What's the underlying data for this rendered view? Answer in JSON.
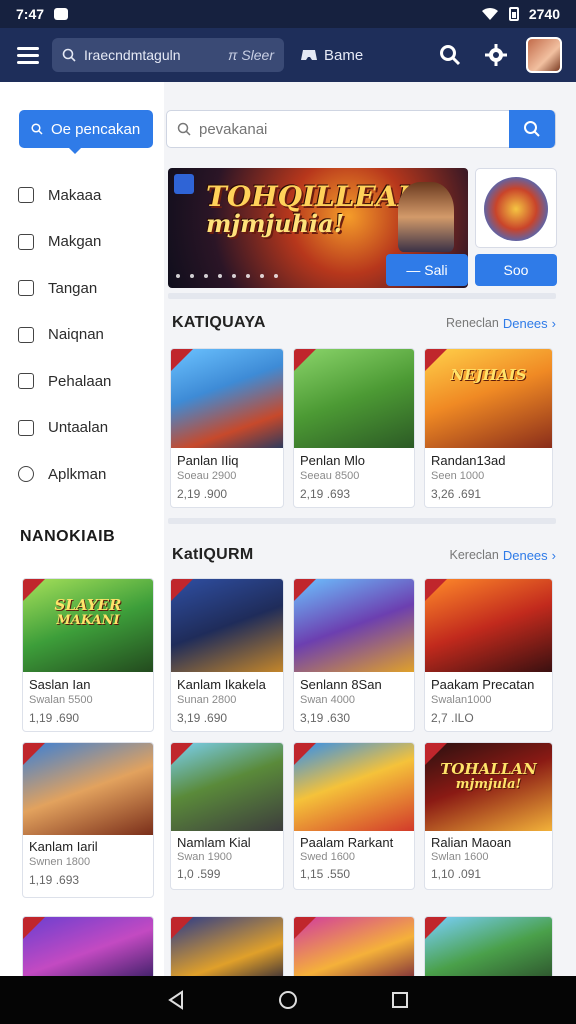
{
  "status_bar": {
    "time": "7:47",
    "battery_text": "2740"
  },
  "app_bar": {
    "search_text": "Iraecndmtaguln",
    "divider_label": "Sleer",
    "game_label": "Bame"
  },
  "sidebar": {
    "category_button": "Oe pencakan",
    "items": [
      {
        "label": "Makaaa",
        "icon": "bookmark-icon"
      },
      {
        "label": "Makgan",
        "icon": "tablet-icon"
      },
      {
        "label": "Tangan",
        "icon": "bag-icon"
      },
      {
        "label": "Naiqnan",
        "icon": "card-icon"
      },
      {
        "label": "Pehalaan",
        "icon": "calendar-icon"
      },
      {
        "label": "Untaalan",
        "icon": "clipboard-icon"
      },
      {
        "label": "Aplkman",
        "icon": "compass-icon"
      }
    ],
    "heading": "NANOKIAIB"
  },
  "search": {
    "placeholder": "pevakanai"
  },
  "banner": {
    "title_line1": "TOHQILLEAH",
    "title_line2": "mjmjuhia!",
    "button": "— Sali",
    "side_button": "Soo"
  },
  "section1": {
    "title": "KATIQUAYA",
    "link_text": "Reneclan",
    "more": "Denees",
    "cards": [
      {
        "name": "Panlan IIiq",
        "sub": "Soeau 2900",
        "price": "2,19 .900",
        "art": "art-1"
      },
      {
        "name": "Penlan Mlo",
        "sub": "Seeau 8500",
        "price": "2,19 .693",
        "art": "art-2",
        "label1": "",
        "label2": ""
      },
      {
        "name": "Randan13ad",
        "sub": "Seen 1000",
        "price": "3,26 .691",
        "art": "art-3",
        "label1": "NEJHAIS",
        "label2": ""
      }
    ]
  },
  "section2": {
    "title": "KatIQURM",
    "link_text": "Kereclan",
    "more": "Denees",
    "rows": [
      [
        {
          "name": "Saslan Ian",
          "sub": "Swalan 5500",
          "price": "1,19 .690",
          "art": "art-4",
          "label1": "SLAYER",
          "label2": "MAKANI"
        },
        {
          "name": "Kanlam Ikakela",
          "sub": "Sunan 2800",
          "price": "3,19 .690",
          "art": "art-5"
        },
        {
          "name": "Senlann 8San",
          "sub": "Swan 4000",
          "price": "3,19 .630",
          "art": "art-6"
        },
        {
          "name": "Paakam Precatan",
          "sub": "Swalan1000",
          "price": "2,7 .ILO",
          "art": "art-7"
        }
      ],
      [
        {
          "name": "Kanlam Iaril",
          "sub": "Swnen 1800",
          "price": "1,19 .693",
          "art": "art-8",
          "label1": "",
          "label2": ""
        },
        {
          "name": "Namlam Kial",
          "sub": "Swan 1900",
          "price": "1,0 .599",
          "art": "art-9",
          "label1": "",
          "label2": ""
        },
        {
          "name": "Paalam Rarkant",
          "sub": "Swed 1600",
          "price": "1,15 .550",
          "art": "art-10",
          "label1": "",
          "label2": ""
        },
        {
          "name": "Ralian Maoan",
          "sub": "Swlan 1600",
          "price": "1,10 .091",
          "art": "art-11",
          "label1": "TOHALLAN",
          "label2": "mjmjula!"
        }
      ],
      [
        {
          "art": "art-12",
          "label1": ""
        },
        {
          "art": "art-13",
          "label1": ""
        },
        {
          "art": "art-14",
          "label1": ""
        },
        {
          "art": "art-15",
          "label1": ""
        }
      ]
    ]
  },
  "colors": {
    "accent": "#2f7be8",
    "appbar": "#1e2e5a",
    "status": "#16213f"
  }
}
